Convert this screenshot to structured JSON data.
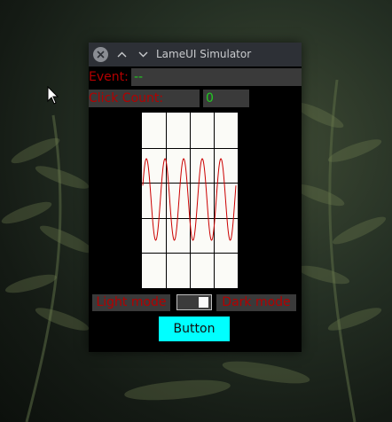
{
  "window": {
    "title": "LameUI Simulator"
  },
  "event": {
    "label": "Event:",
    "value": "--"
  },
  "click_count": {
    "label": "Click Count:",
    "value": "0"
  },
  "plot": {
    "grid_rows": 5,
    "grid_cols": 4,
    "waveform": "sine",
    "cycles_visible": 5,
    "line_color": "#cc0000",
    "background": "#fbfbf7",
    "grid_color": "#000000"
  },
  "theme_toggle": {
    "light_label": "Light mode",
    "dark_label": "Dark mode",
    "state": "dark"
  },
  "button": {
    "label": "Button"
  },
  "colors": {
    "label_red": "#b30000",
    "value_green": "#22cc22",
    "button_cyan": "#00ffff",
    "window_bg": "#000000",
    "titlebar": "#2d3036"
  }
}
